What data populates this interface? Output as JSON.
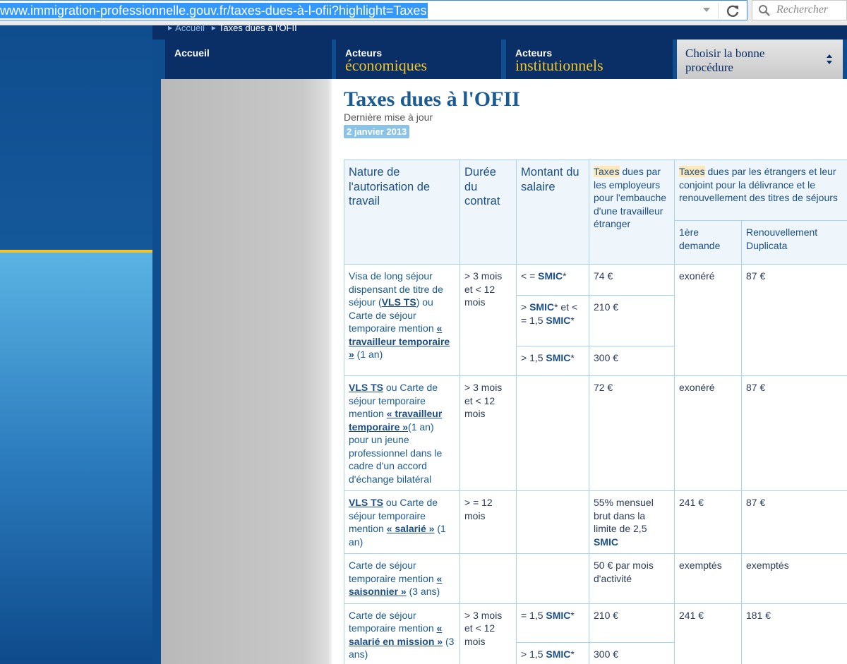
{
  "browser": {
    "url": "www.immigration-professionnelle.gouv.fr/taxes-dues-à-l-ofii?highlight=Taxes",
    "search_placeholder": "Rechercher"
  },
  "breadcrumb": {
    "home": "Accueil",
    "current": "Taxes dues à l'OFII"
  },
  "nav": {
    "accueil": "Accueil",
    "eco_small": "Acteurs",
    "eco_big": "économiques",
    "inst_small": "Acteurs",
    "inst_big": "institutionnels",
    "choisir_line1": "Choisir la bonne",
    "choisir_line2": "procédure"
  },
  "page": {
    "title": "Taxes dues à l'OFII",
    "update_label": "Dernière mise à jour",
    "update_date": "2 janvier 2013"
  },
  "table": {
    "headers": {
      "nature": "Nature de l'autorisation de travail",
      "duree": "Durée du contrat",
      "montant": "Montant du salaire",
      "emp_hl": "Taxes",
      "emp_rest": " dues par les employeurs pour l'embauche d'une travailleur étranger",
      "etr_hl": "Taxes",
      "etr_rest": " dues par les étrangers et leur conjoint pour la délivrance et le renouvellement des titres de séjours",
      "premiere": "1ère demande",
      "renouv": "Renouvellement Duplicata"
    },
    "r1": {
      "n_a": "Visa de long séjour dispensant de titre de séjour (",
      "n_link1": "VLS TS",
      "n_b": ") ou Carte de séjour temporaire mention ",
      "n_link2": "« travailleur temporaire »",
      "n_c": " (1 an)",
      "duree": "> 3 mois et < 12 mois",
      "s1_a": "< = ",
      "s1_smic": "SMIC",
      "s1_b": "*",
      "t1": "74 €",
      "s2_a": "> ",
      "s2_smic": "SMIC",
      "s2_b": "* et < = 1,5 ",
      "s2_smic2": "SMIC",
      "s2_c": "*",
      "t2": "210 €",
      "s3_a": "> 1,5 ",
      "s3_smic": "SMIC",
      "s3_b": "*",
      "t3": "300 €",
      "premiere": "exonéré",
      "renouv": "87 €"
    },
    "r2": {
      "n_link1": "VLS TS",
      "n_a": " ou Carte de séjour temporaire mention ",
      "n_link2": "« travailleur temporaire »",
      "n_b": "(1 an) pour un jeune professionnel dans le cadre d'un accord d'échange bilatéral",
      "duree": "> 3 mois et < 12 mois",
      "taxe": "72 €",
      "premiere": "exonéré",
      "renouv": "87 €"
    },
    "r3": {
      "n_link1": "VLS TS",
      "n_a": " ou Carte de séjour temporaire mention ",
      "n_link2": "« salarié »",
      "n_b": " (1 an)",
      "duree": "> = 12 mois",
      "taxe_a": "55% mensuel brut dans la limite de 2,5 ",
      "taxe_smic": "SMIC",
      "premiere": "241 €",
      "renouv": "87 €"
    },
    "r4": {
      "n_a": "Carte de séjour temporaire mention ",
      "n_link": "« saisonnier »",
      "n_b": " (3 ans)",
      "taxe": "50 € par mois d'activité",
      "premiere": "exemptés",
      "renouv": "exemptés"
    },
    "r5": {
      "n_a": "Carte de séjour temporaire mention ",
      "n_link": "« salarié en mission »",
      "n_b": " (3 ans)",
      "duree": "> 3 mois et < 12 mois",
      "s1_a": "= 1,5 ",
      "s1_smic": "SMIC",
      "s1_b": "*",
      "t1": "210 €",
      "s2_a": "> 1,5 ",
      "s2_smic": "SMIC",
      "s2_b": "*",
      "t2": "300 €",
      "premiere": "241 €",
      "renouv": "181 €"
    }
  }
}
